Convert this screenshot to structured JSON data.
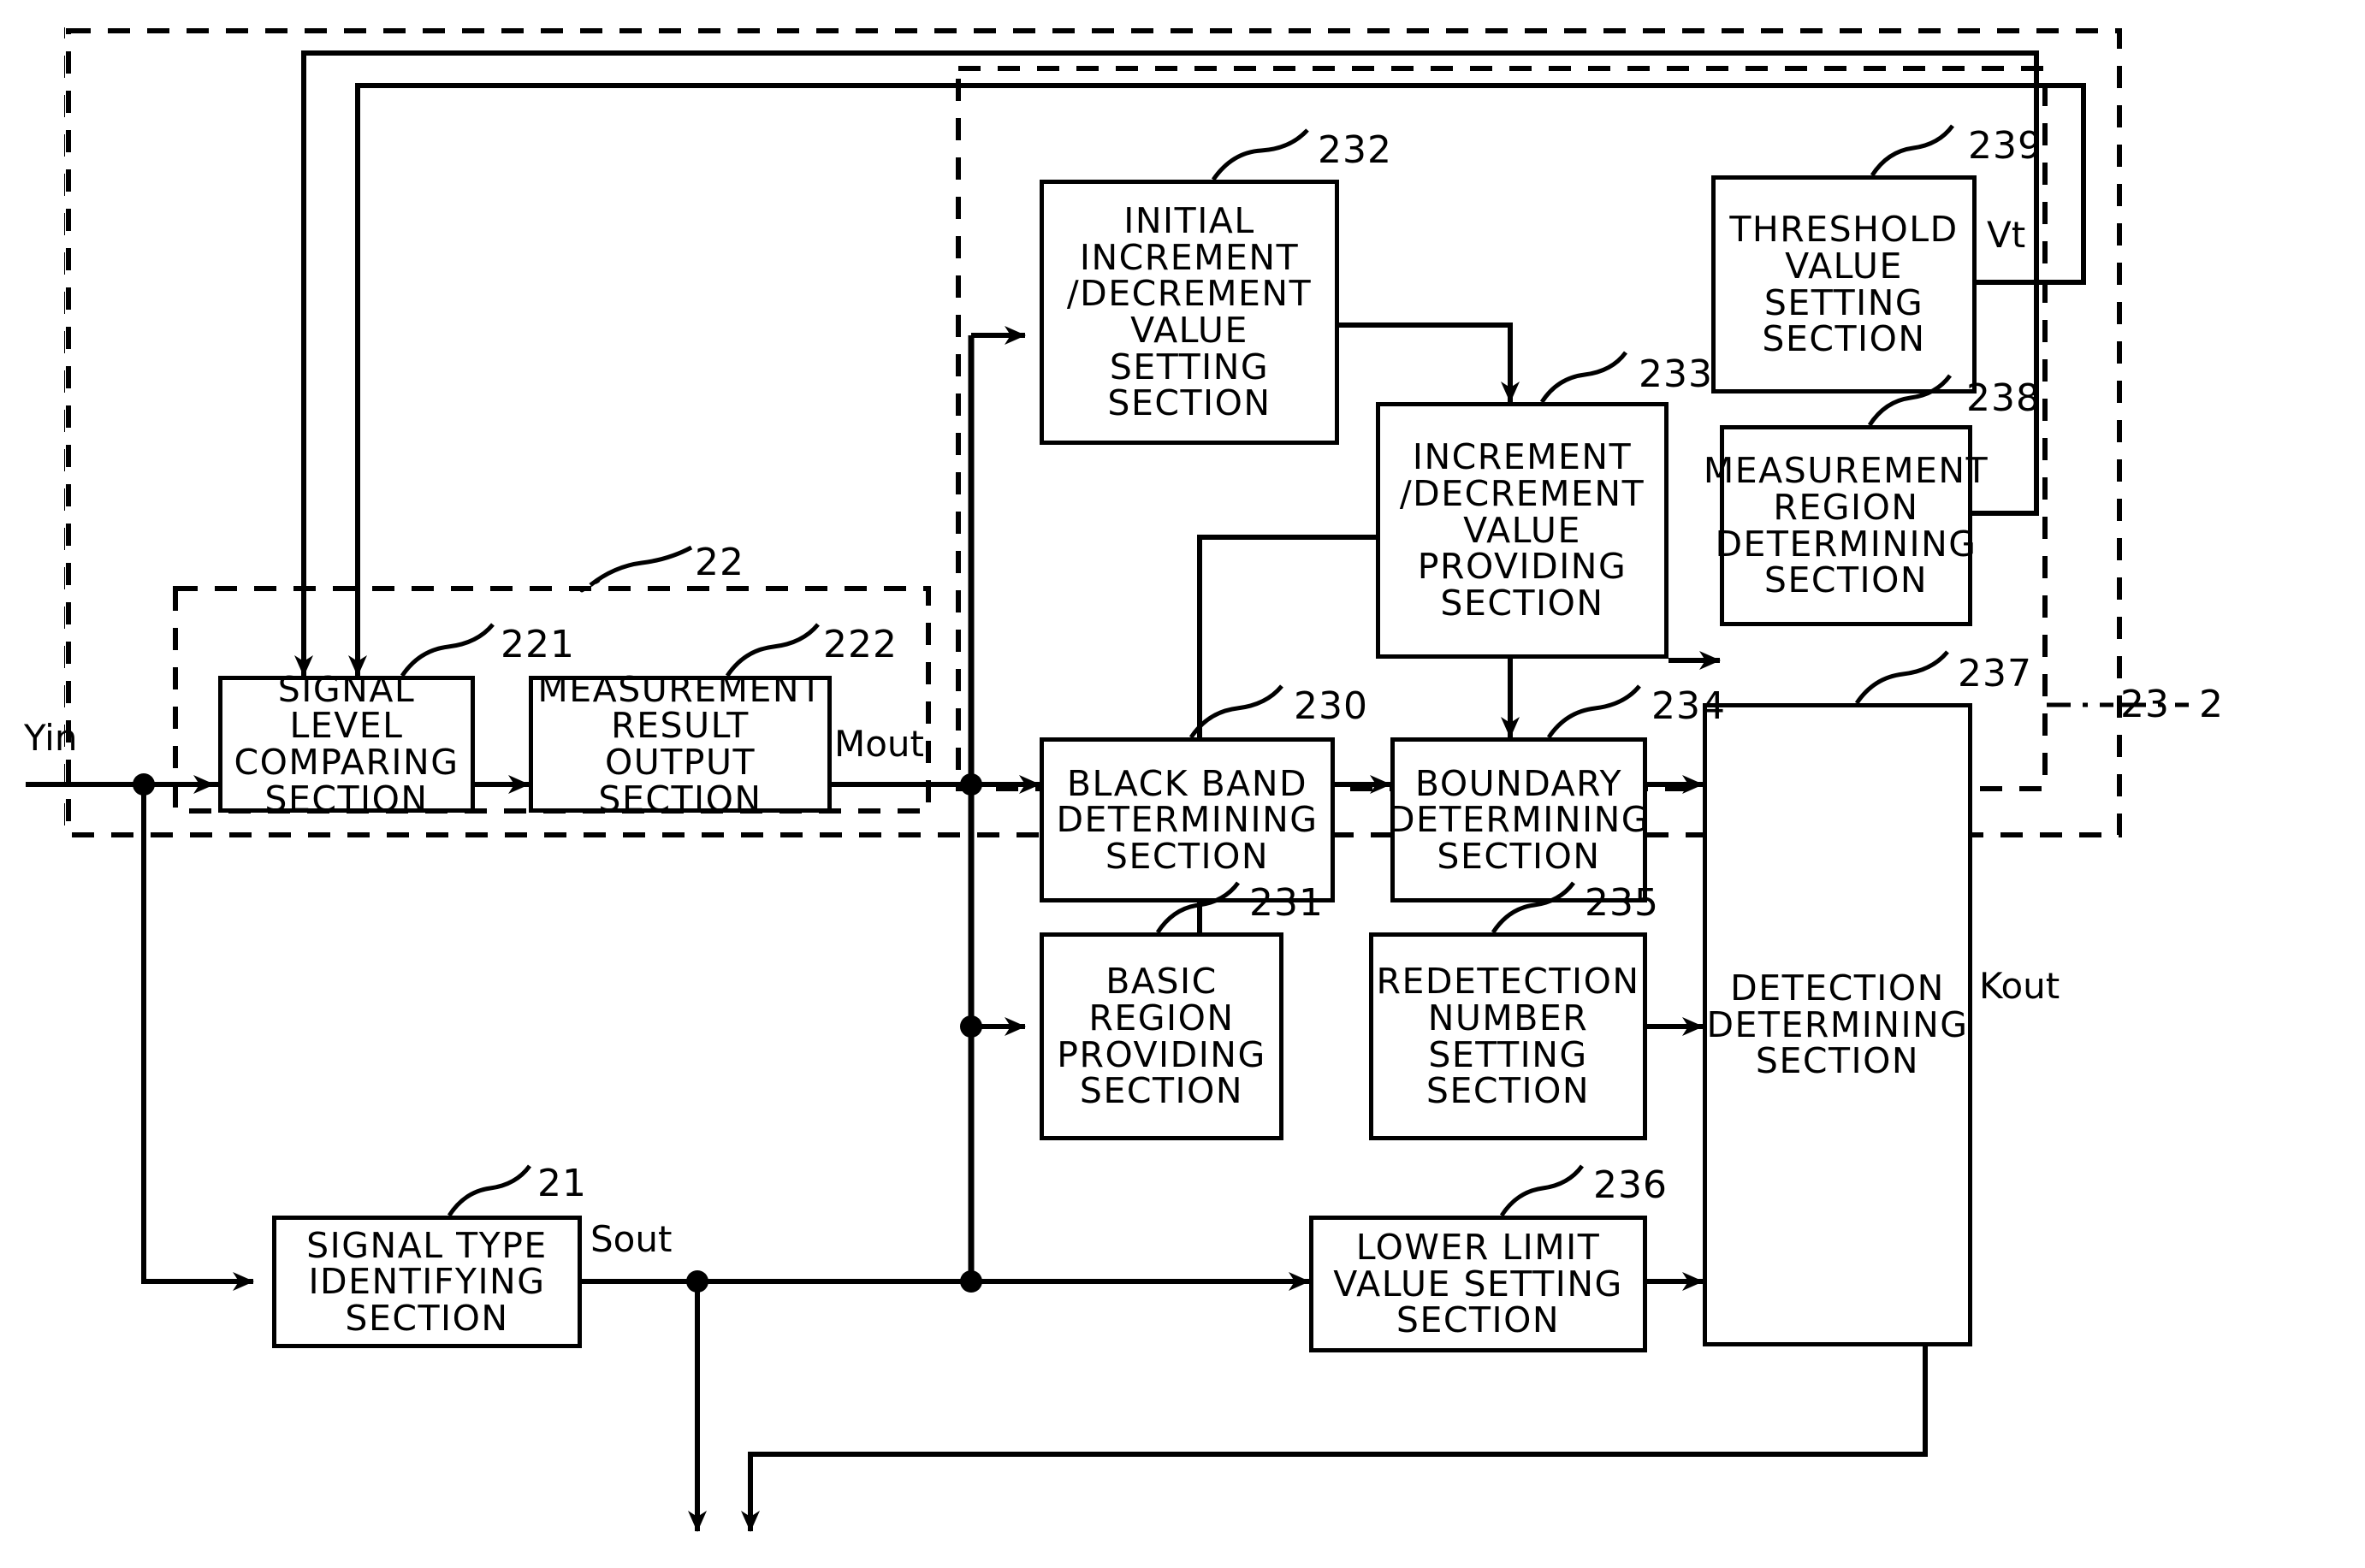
{
  "figure": {
    "type": "patent-block-diagram",
    "outer_label": "2",
    "groups": [
      {
        "id": "22",
        "label": "22"
      },
      {
        "id": "23",
        "label": "23"
      }
    ]
  },
  "signals": {
    "input": "Yin",
    "measurement_out": "Mout",
    "signal_type_out": "Sout",
    "threshold_out": "Vt",
    "detection_out": "Kout"
  },
  "blocks": [
    {
      "ref": "21",
      "name": "signal-type-identifying-section",
      "label": "SIGNAL TYPE\nIDENTIFYING\nSECTION"
    },
    {
      "ref": "221",
      "name": "signal-level-comparing-section",
      "label": "SIGNAL\nLEVEL\nCOMPARING\nSECTION"
    },
    {
      "ref": "222",
      "name": "measurement-result-output-section",
      "label": "MEASUREMENT\nRESULT\nOUTPUT\nSECTION"
    },
    {
      "ref": "230",
      "name": "black-band-determining-section",
      "label": "BLACK BAND\nDETERMINING\nSECTION"
    },
    {
      "ref": "231",
      "name": "basic-region-providing-section",
      "label": "BASIC\nREGION\nPROVIDING\nSECTION"
    },
    {
      "ref": "232",
      "name": "initial-increment-decrement-value-setting-section",
      "label": "INITIAL\nINCREMENT\n/DECREMENT\nVALUE\nSETTING\nSECTION"
    },
    {
      "ref": "233",
      "name": "increment-decrement-value-providing-section",
      "label": "INCREMENT\n/DECREMENT\nVALUE\nPROVIDING\nSECTION"
    },
    {
      "ref": "234",
      "name": "boundary-determining-section",
      "label": "BOUNDARY\nDETERMINING\nSECTION"
    },
    {
      "ref": "235",
      "name": "redetection-number-setting-section",
      "label": "REDETECTION\nNUMBER\nSETTING\nSECTION"
    },
    {
      "ref": "236",
      "name": "lower-limit-value-setting-section",
      "label": "LOWER LIMIT\nVALUE SETTING\nSECTION"
    },
    {
      "ref": "237",
      "name": "detection-determining-section",
      "label": "DETECTION\nDETERMINING\nSECTION"
    },
    {
      "ref": "238",
      "name": "measurement-region-determining-section",
      "label": "MEASUREMENT\nREGION\nDETERMINING\nSECTION"
    },
    {
      "ref": "239",
      "name": "threshold-value-setting-section",
      "label": "THRESHOLD\nVALUE\nSETTING\nSECTION"
    }
  ],
  "colors": {
    "ink": "#000000",
    "paper": "#ffffff"
  }
}
